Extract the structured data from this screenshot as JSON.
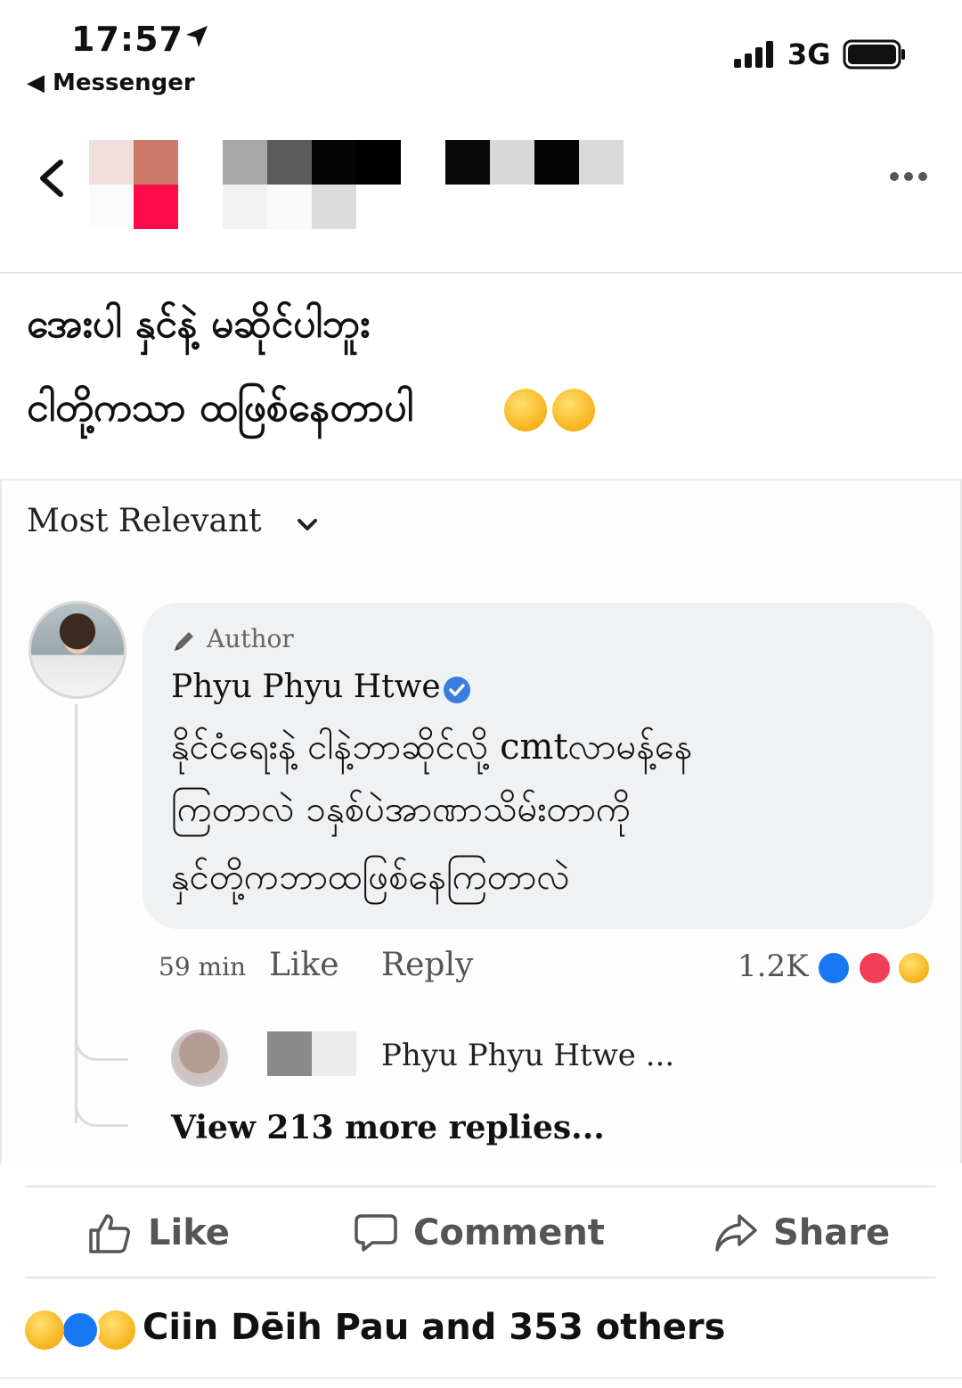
{
  "status_bar": {
    "time": "17:57",
    "back_app": "Messenger",
    "network": "3G"
  },
  "post": {
    "line1": "အေးပါ နှင်နဲ့ မဆိုင်ပါဘူး",
    "line2": "ငါတို့ကသာ ထဖြစ်နေတာပါ"
  },
  "comments": {
    "sort_label": "Most Relevant",
    "top_comment": {
      "author_badge": "Author",
      "name": "Phyu Phyu Htwe",
      "lines": [
        "နိုင်ငံရေးနဲ့ ငါနဲ့ဘာဆိုင်လို့ cmtလာမန့်နေ",
        "ကြတာလဲ ၁နှစ်ပဲအာဏာသိမ်းတာကို",
        "နှင်တို့ကဘာထဖြစ်နေကြတာလဲ"
      ],
      "time": "59 min",
      "like": "Like",
      "reply": "Reply",
      "reaction_count": "1.2K"
    },
    "reply_preview_name": "Phyu Phyu Htwe ...",
    "view_more": "View 213 more replies..."
  },
  "actions": {
    "like": "Like",
    "comment": "Comment",
    "share": "Share"
  },
  "summary": "Ciin Dēih Pau and 353 others",
  "colors": {
    "like_blue": "#1877f2",
    "love_red": "#f33e58",
    "emoji_yellow": "#f7b31b"
  }
}
